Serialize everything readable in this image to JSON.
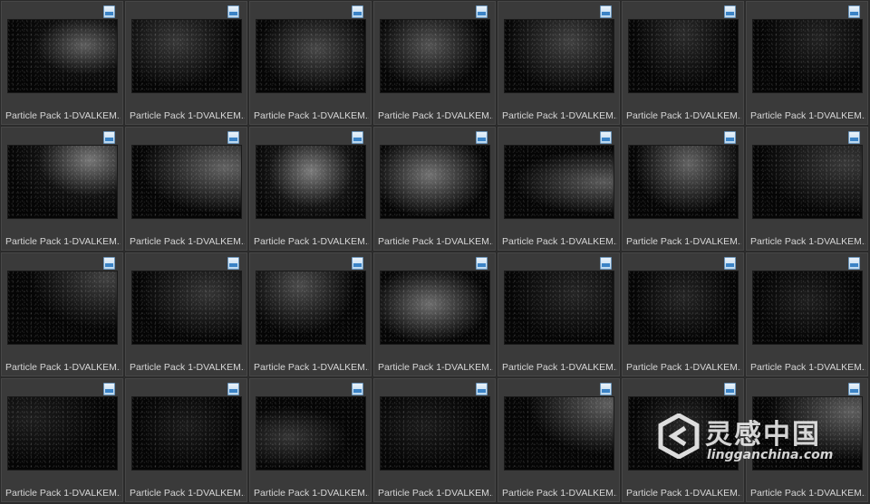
{
  "file_browser": {
    "file_type_icon": "image-file-icon",
    "items": [
      {
        "name": "Particle Pack 1-DVALKEM..."
      },
      {
        "name": "Particle Pack 1-DVALKEM..."
      },
      {
        "name": "Particle Pack 1-DVALKEM..."
      },
      {
        "name": "Particle Pack 1-DVALKEM..."
      },
      {
        "name": "Particle Pack 1-DVALKEM..."
      },
      {
        "name": "Particle Pack 1-DVALKEM..."
      },
      {
        "name": "Particle Pack 1-DVALKEM..."
      },
      {
        "name": "Particle Pack 1-DVALKEM..."
      },
      {
        "name": "Particle Pack 1-DVALKEM..."
      },
      {
        "name": "Particle Pack 1-DVALKEM..."
      },
      {
        "name": "Particle Pack 1-DVALKEM..."
      },
      {
        "name": "Particle Pack 1-DVALKEM..."
      },
      {
        "name": "Particle Pack 1-DVALKEM..."
      },
      {
        "name": "Particle Pack 1-DVALKEM..."
      },
      {
        "name": "Particle Pack 1-DVALKEM..."
      },
      {
        "name": "Particle Pack 1-DVALKEM..."
      },
      {
        "name": "Particle Pack 1-DVALKEM..."
      },
      {
        "name": "Particle Pack 1-DVALKEM..."
      },
      {
        "name": "Particle Pack 1-DVALKEM..."
      },
      {
        "name": "Particle Pack 1-DVALKEM..."
      },
      {
        "name": "Particle Pack 1-DVALKEM..."
      },
      {
        "name": "Particle Pack 1-DVALKEM..."
      },
      {
        "name": "Particle Pack 1-DVALKEM..."
      },
      {
        "name": "Particle Pack 1-DVALKEM..."
      },
      {
        "name": "Particle Pack 1-DVALKEM..."
      },
      {
        "name": "Particle Pack 1-DVALKEM..."
      },
      {
        "name": "Particle Pack 1-DVALKEM..."
      },
      {
        "name": "Particle Pack 1-DVALKEM..."
      }
    ]
  },
  "watermark": {
    "brand_cn": "灵感中国",
    "url": "lingganchina.com",
    "logo_icon": "lingganchina-logo-icon"
  }
}
